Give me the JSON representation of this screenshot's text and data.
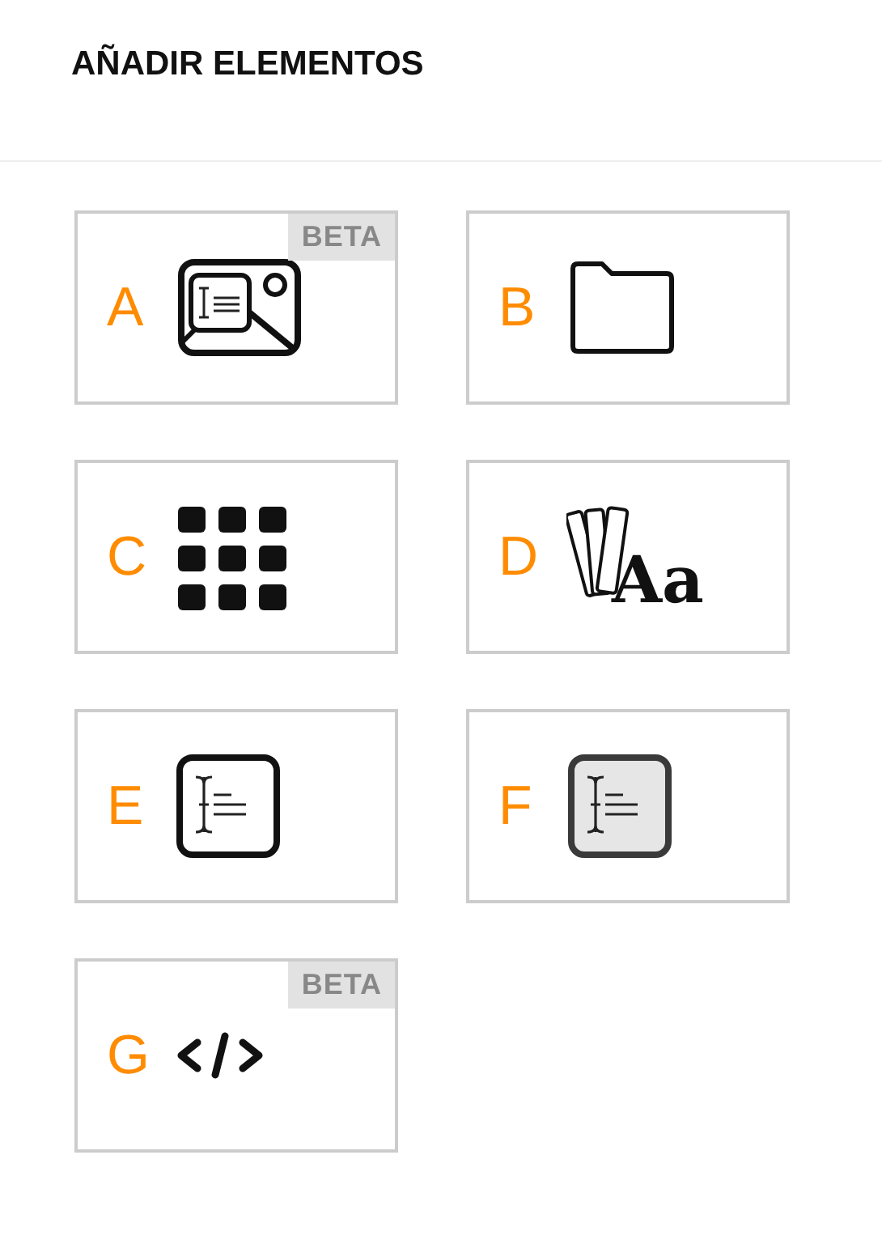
{
  "title": "AÑADIR ELEMENTOS",
  "elements": [
    {
      "letter": "A",
      "kind": "image-text",
      "beta": true,
      "badge": "BETA"
    },
    {
      "letter": "B",
      "kind": "folder",
      "beta": false
    },
    {
      "letter": "C",
      "kind": "grid",
      "beta": false
    },
    {
      "letter": "D",
      "kind": "typography",
      "beta": false,
      "glyph": "Aa"
    },
    {
      "letter": "E",
      "kind": "text-box",
      "beta": false
    },
    {
      "letter": "F",
      "kind": "text-box-filled",
      "beta": false
    },
    {
      "letter": "G",
      "kind": "code",
      "beta": true,
      "badge": "BETA"
    }
  ]
}
